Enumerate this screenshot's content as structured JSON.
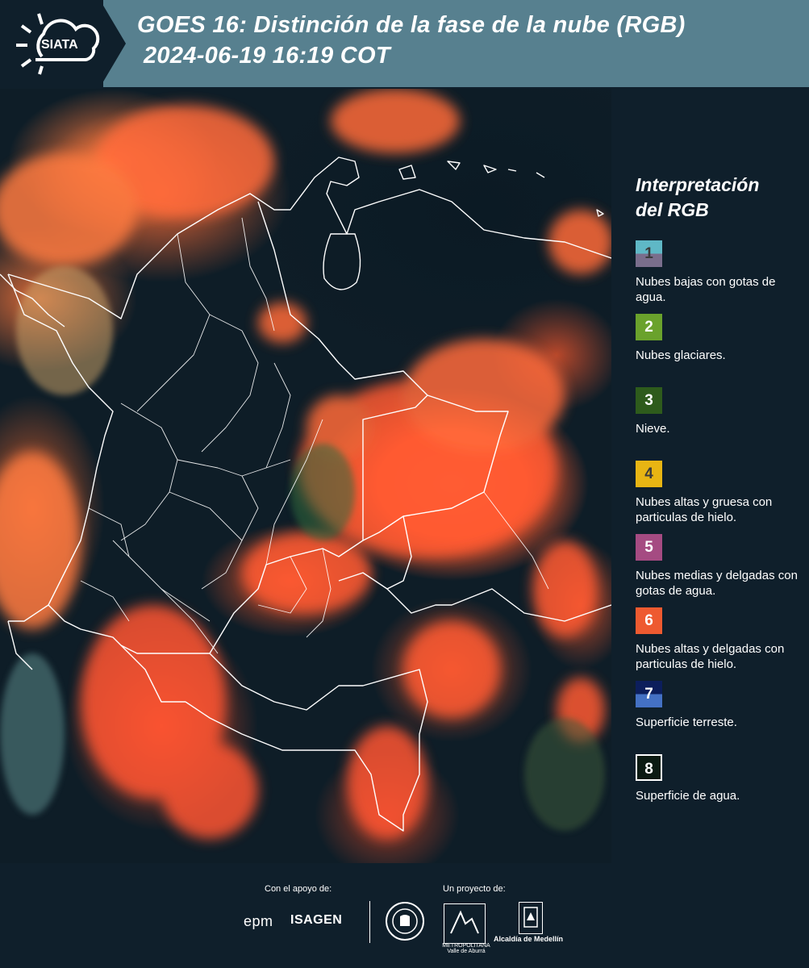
{
  "header": {
    "brand": "SIATA",
    "title_line1": "GOES 16: Distinción de la fase de la nube (RGB)",
    "title_line2": "2024-06-19 16:19 COT"
  },
  "legend": {
    "title_line1": "Interpretación",
    "title_line2": "del RGB",
    "items": [
      {
        "number": "1",
        "label": "Nubes bajas con gotas de agua.",
        "color_top": "#5fb8c6",
        "color_bottom": "#7a6e8c",
        "text_color": "#3b3b3b"
      },
      {
        "number": "2",
        "label": "Nubes glaciares.",
        "color_top": "#6aa22c",
        "color_bottom": "#6aa22c",
        "text_color": "#ffffff"
      },
      {
        "number": "3",
        "label": "Nieve.",
        "color_top": "#2e5b1c",
        "color_bottom": "#2e5b1c",
        "text_color": "#ffffff"
      },
      {
        "number": "4",
        "label": "Nubes altas y gruesa con particulas de hielo.",
        "color_top": "#e8b513",
        "color_bottom": "#e8b513",
        "text_color": "#3b3b3b"
      },
      {
        "number": "5",
        "label": "Nubes medias y delgadas con gotas de agua.",
        "color_top": "#a54b82",
        "color_bottom": "#a54b82",
        "text_color": "#ffffff"
      },
      {
        "number": "6",
        "label": "Nubes altas y delgadas con particulas de hielo.",
        "color_top": "#ee5a30",
        "color_bottom": "#ee5a30",
        "text_color": "#ffffff"
      },
      {
        "number": "7",
        "label": "Superficie terreste.",
        "color_top": "#0c1e5c",
        "color_bottom": "#4471c4",
        "text_color": "#ffffff"
      },
      {
        "number": "8",
        "label": "Superficie de agua.",
        "color_top": "#0b1a12",
        "color_bottom": "#0b1a12",
        "text_color": "#ffffff"
      }
    ]
  },
  "footer": {
    "support_label": "Con el apoyo de:",
    "project_label": "Un proyecto de:",
    "sponsor1": "epm",
    "sponsor2": "ISAGEN",
    "partner_metro": "METROPOLITANA Valle de Aburrá",
    "partner_alcaldia": "Alcaldía de Medellín"
  }
}
